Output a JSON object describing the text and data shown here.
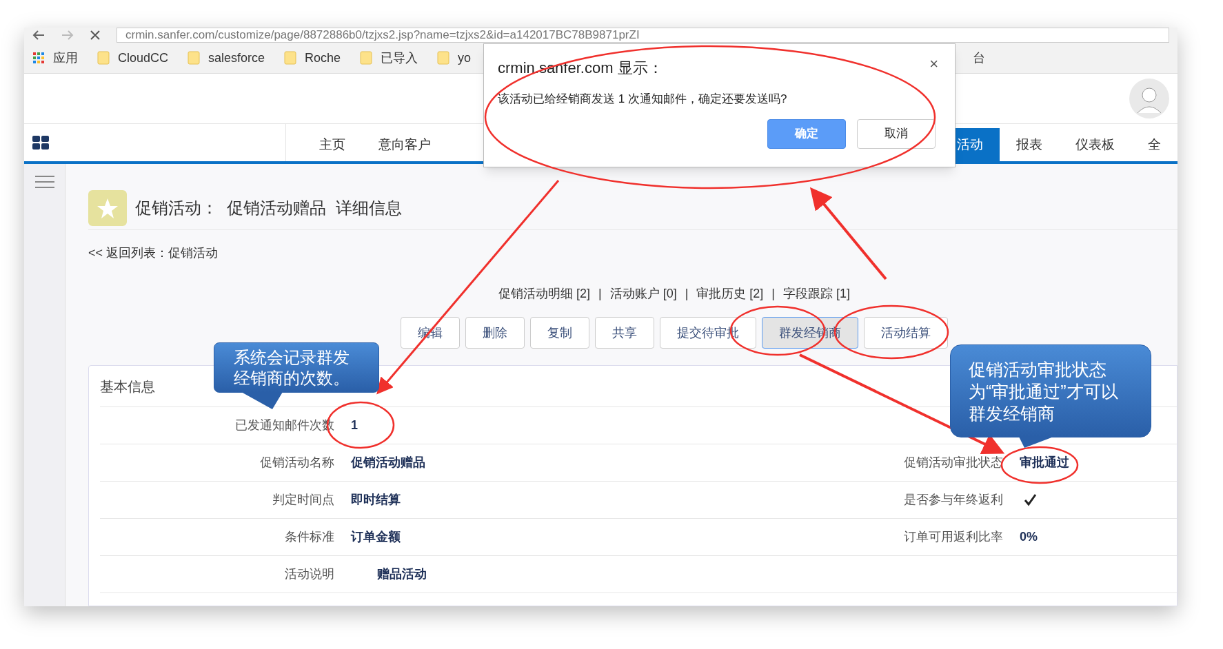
{
  "browser": {
    "url": "crmin.sanfer.com/customize/page/8872886b0/tzjxs2.jsp?name=tzjxs2&id=a142017BC78B9871prZI",
    "bookmarks": [
      {
        "label": "应用",
        "kind": "apps"
      },
      {
        "label": "CloudCC",
        "kind": "folder"
      },
      {
        "label": "salesforce",
        "kind": "folder"
      },
      {
        "label": "Roche",
        "kind": "folder"
      },
      {
        "label": "已导入",
        "kind": "folder"
      },
      {
        "label": "yo",
        "kind": "folder"
      },
      {
        "label": "台",
        "kind": "plain"
      }
    ]
  },
  "nav": {
    "tabs": [
      {
        "label": "主页",
        "selected": false
      },
      {
        "label": "意向客户",
        "selected": false
      },
      {
        "label": "活动",
        "selected": true
      },
      {
        "label": "报表",
        "selected": false
      },
      {
        "label": "仪表板",
        "selected": false
      },
      {
        "label": "全",
        "selected": false
      }
    ]
  },
  "page": {
    "object": "促销活动：",
    "record": "促销活动赠品",
    "suffix": "详细信息",
    "back_link": "<< 返回列表：促销活动",
    "related_links": [
      "促销活动明细 [2]",
      "活动账户 [0]",
      "审批历史 [2]",
      "字段跟踪 [1]"
    ],
    "separator": "|",
    "buttons": [
      {
        "label": "编辑",
        "pressed": false
      },
      {
        "label": "删除",
        "pressed": false
      },
      {
        "label": "复制",
        "pressed": false
      },
      {
        "label": "共享",
        "pressed": false
      },
      {
        "label": "提交待审批",
        "pressed": false
      },
      {
        "label": "群发经销商",
        "pressed": true
      },
      {
        "label": "活动结算",
        "pressed": false
      }
    ],
    "section": {
      "title": "基本信息",
      "rows": [
        {
          "left": {
            "label": "已发通知邮件次数",
            "value": "1"
          }
        },
        {
          "left": {
            "label": "促销活动名称",
            "value": "促销活动赠品"
          },
          "right": {
            "kind": "text",
            "label": "促销活动审批状态",
            "value": "审批通过"
          }
        },
        {
          "left": {
            "label": "判定时间点",
            "value": "即时结算"
          },
          "right": {
            "kind": "checkbox",
            "label": "是否参与年终返利",
            "checked": true
          }
        },
        {
          "left": {
            "label": "条件标准",
            "value": "订单金额"
          },
          "right": {
            "kind": "text",
            "label": "订单可用返利比率",
            "value": "0%"
          }
        },
        {
          "left": {
            "label": "活动说明",
            "value": "赠品活动",
            "indented": true
          }
        }
      ]
    }
  },
  "dialog": {
    "title": "crmin.sanfer.com 显示：",
    "close": "×",
    "message": "该活动已给经销商发送 1 次通知邮件，确定还要发送吗?",
    "buttons": [
      {
        "label": "确定",
        "kind": "primary"
      },
      {
        "label": "取消",
        "kind": "secondary"
      }
    ]
  },
  "callouts": [
    "系统会记录群发经销商的次数。",
    "促销活动审批状态为“审批通过”才可以群发经销商"
  ]
}
